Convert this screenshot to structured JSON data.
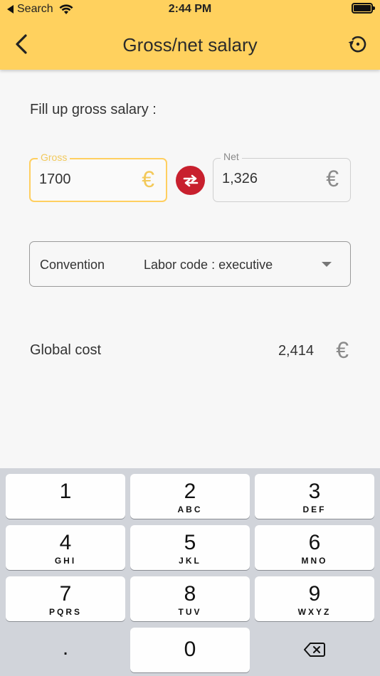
{
  "status_bar": {
    "back_app": "Search",
    "time": "2:44 PM"
  },
  "header": {
    "title": "Gross/net salary"
  },
  "form": {
    "instruction": "Fill up gross salary :",
    "gross": {
      "label": "Gross",
      "value": "1700",
      "currency": "€"
    },
    "net": {
      "label": "Net",
      "value": "1,326",
      "currency": "€"
    },
    "convention": {
      "label": "Convention",
      "value": "Labor code : executive"
    },
    "global_cost": {
      "label": "Global cost",
      "value": "2,414",
      "currency": "€"
    }
  },
  "keyboard": {
    "keys": [
      {
        "digit": "1",
        "letters": ""
      },
      {
        "digit": "2",
        "letters": "ABC"
      },
      {
        "digit": "3",
        "letters": "DEF"
      },
      {
        "digit": "4",
        "letters": "GHI"
      },
      {
        "digit": "5",
        "letters": "JKL"
      },
      {
        "digit": "6",
        "letters": "MNO"
      },
      {
        "digit": "7",
        "letters": "PQRS"
      },
      {
        "digit": "8",
        "letters": "TUV"
      },
      {
        "digit": "9",
        "letters": "WXYZ"
      },
      {
        "digit": ".",
        "letters": ""
      },
      {
        "digit": "0",
        "letters": ""
      }
    ]
  },
  "colors": {
    "header_bg": "#ffd15e",
    "accent_yellow": "#ffcf60",
    "swap_red": "#c8202e"
  },
  "icons": [
    "back-arrow-icon",
    "history-icon",
    "swap-arrows-icon",
    "caret-down-icon",
    "backspace-icon",
    "wifi-icon",
    "battery-icon"
  ]
}
